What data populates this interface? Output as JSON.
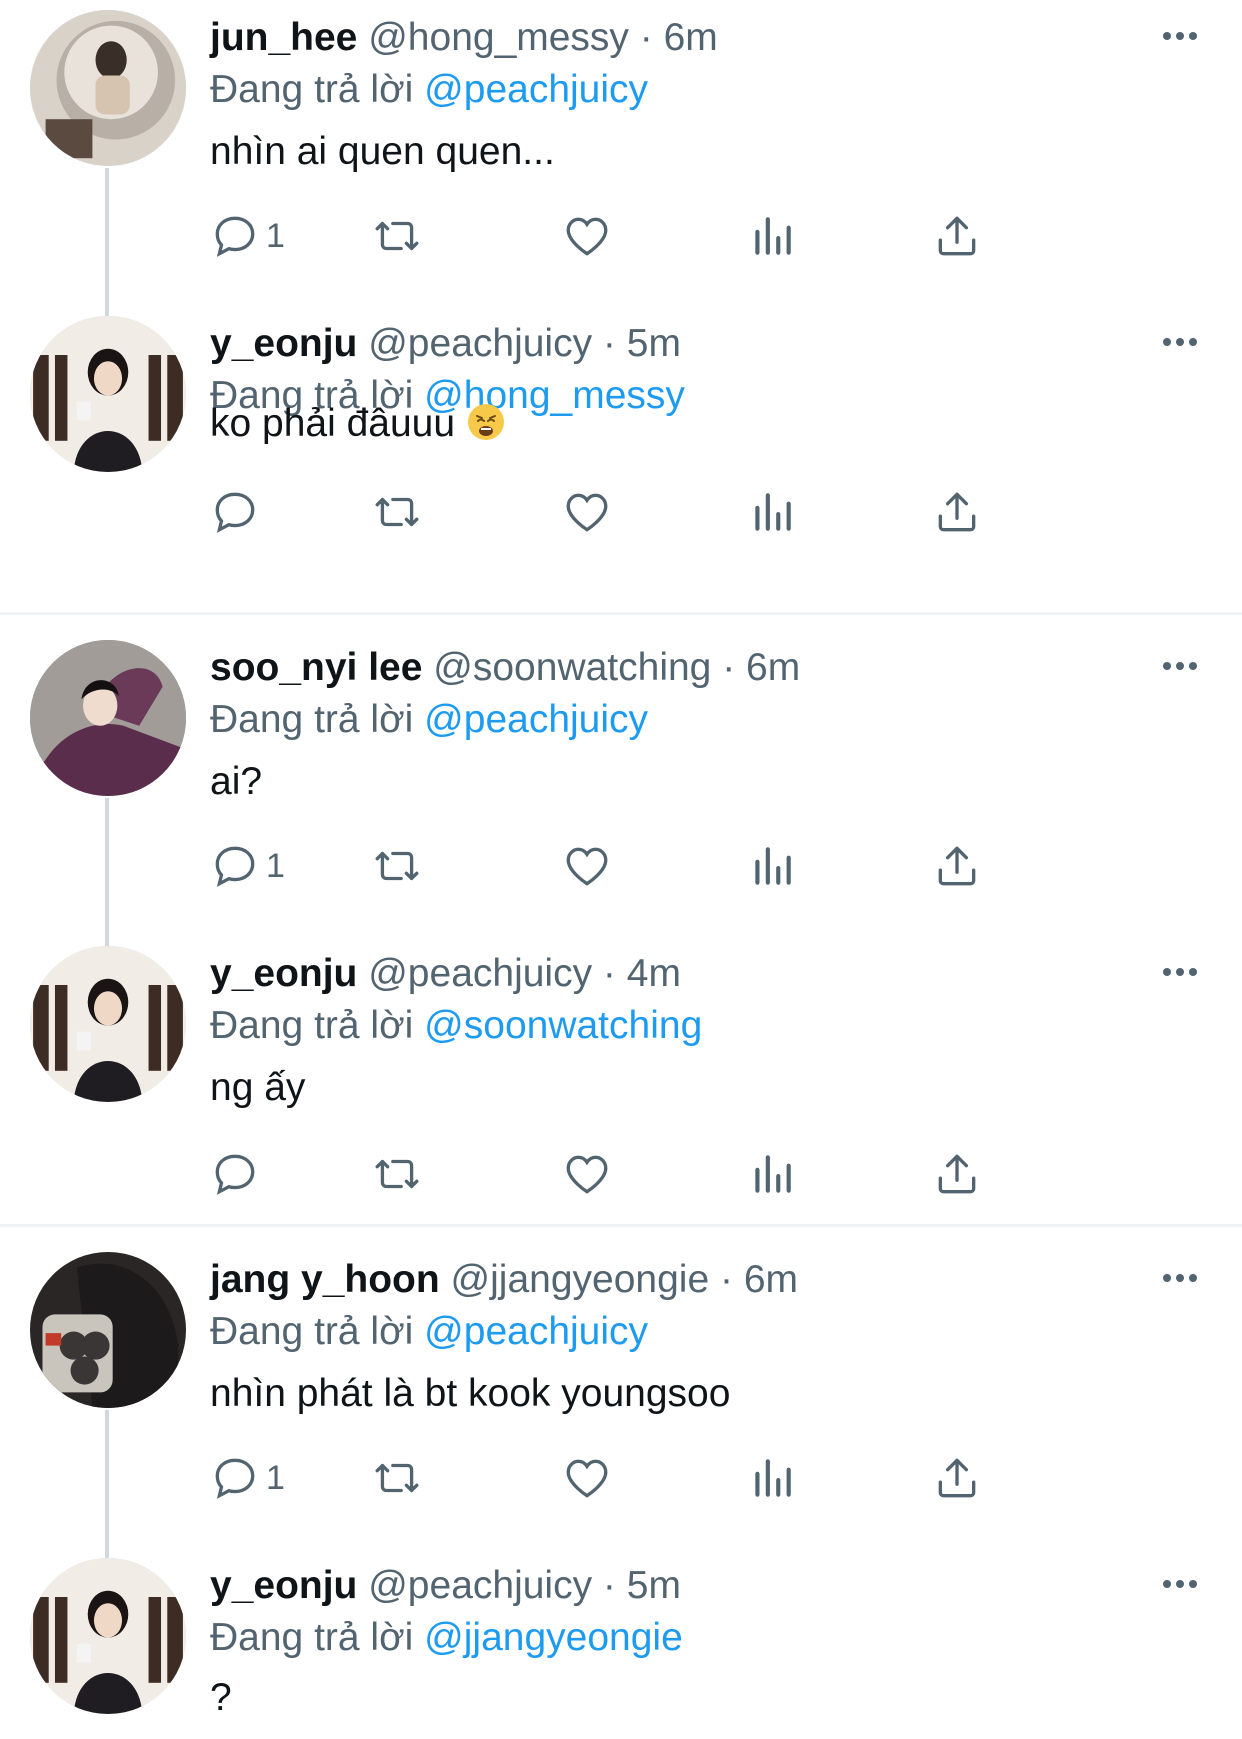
{
  "reply_prefix": "Đang trả lời",
  "tweets": [
    {
      "name": "jun_hee",
      "handle": "@hong_messy",
      "time": "6m",
      "reply_to": "@peachjuicy",
      "text": "nhìn ai quen quen...",
      "reply_count": "1"
    },
    {
      "name": "y_eonju",
      "handle": "@peachjuicy",
      "time": "5m",
      "reply_to": "@hong_messy",
      "text": "ko phải đâuuu",
      "reply_count": ""
    },
    {
      "name": "soo_nyi lee",
      "handle": "@soonwatching",
      "time": "6m",
      "reply_to": "@peachjuicy",
      "text": "ai?",
      "reply_count": "1"
    },
    {
      "name": "y_eonju",
      "handle": "@peachjuicy",
      "time": "4m",
      "reply_to": "@soonwatching",
      "text": "ng ấy",
      "reply_count": ""
    },
    {
      "name": "jang y_hoon",
      "handle": "@jjangyeongie",
      "time": "6m",
      "reply_to": "@peachjuicy",
      "text": "nhìn phát là bt kook youngsoo",
      "reply_count": "1"
    },
    {
      "name": "y_eonju",
      "handle": "@peachjuicy",
      "time": "5m",
      "reply_to": "@jjangyeongie",
      "text": "?",
      "reply_count": ""
    }
  ],
  "icons": [
    "reply-icon",
    "retweet-icon",
    "like-icon",
    "analytics-icon",
    "share-icon",
    "more-icon",
    "weary-face-emoji"
  ],
  "colors": {
    "accent": "#1d9bf0",
    "secondary_text": "#536471",
    "primary_text": "#0f1419",
    "thread_line": "#cfd9de",
    "divider": "#eff3f4"
  }
}
